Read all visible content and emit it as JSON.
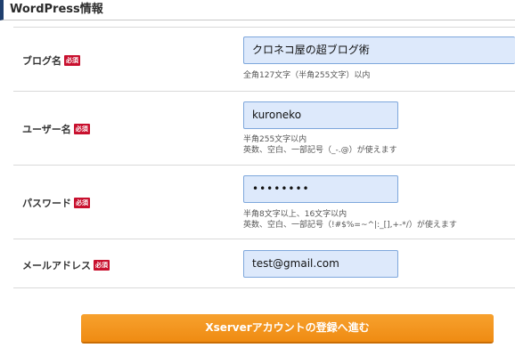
{
  "section": {
    "title": "WordPress情報"
  },
  "required_badge": "必須",
  "fields": {
    "blog_name": {
      "label": "ブログ名",
      "value": "クロネコ屋の超ブログ術",
      "hint": "全角127文字（半角255文字）以内"
    },
    "username": {
      "label": "ユーザー名",
      "value": "kuroneko",
      "hint1": "半角255文字以内",
      "hint2": "英数、空白、一部記号（_-.@）が使えます"
    },
    "password": {
      "label": "パスワード",
      "value": "••••••••",
      "hint1": "半角8文字以上、16文字以内",
      "hint2": "英数、空白、一部記号（!#$%=~^|:_[],+-*/）が使えます"
    },
    "email": {
      "label": "メールアドレス",
      "value": "test@gmail.com"
    }
  },
  "submit": {
    "label": "Xserverアカウントの登録へ進む"
  }
}
